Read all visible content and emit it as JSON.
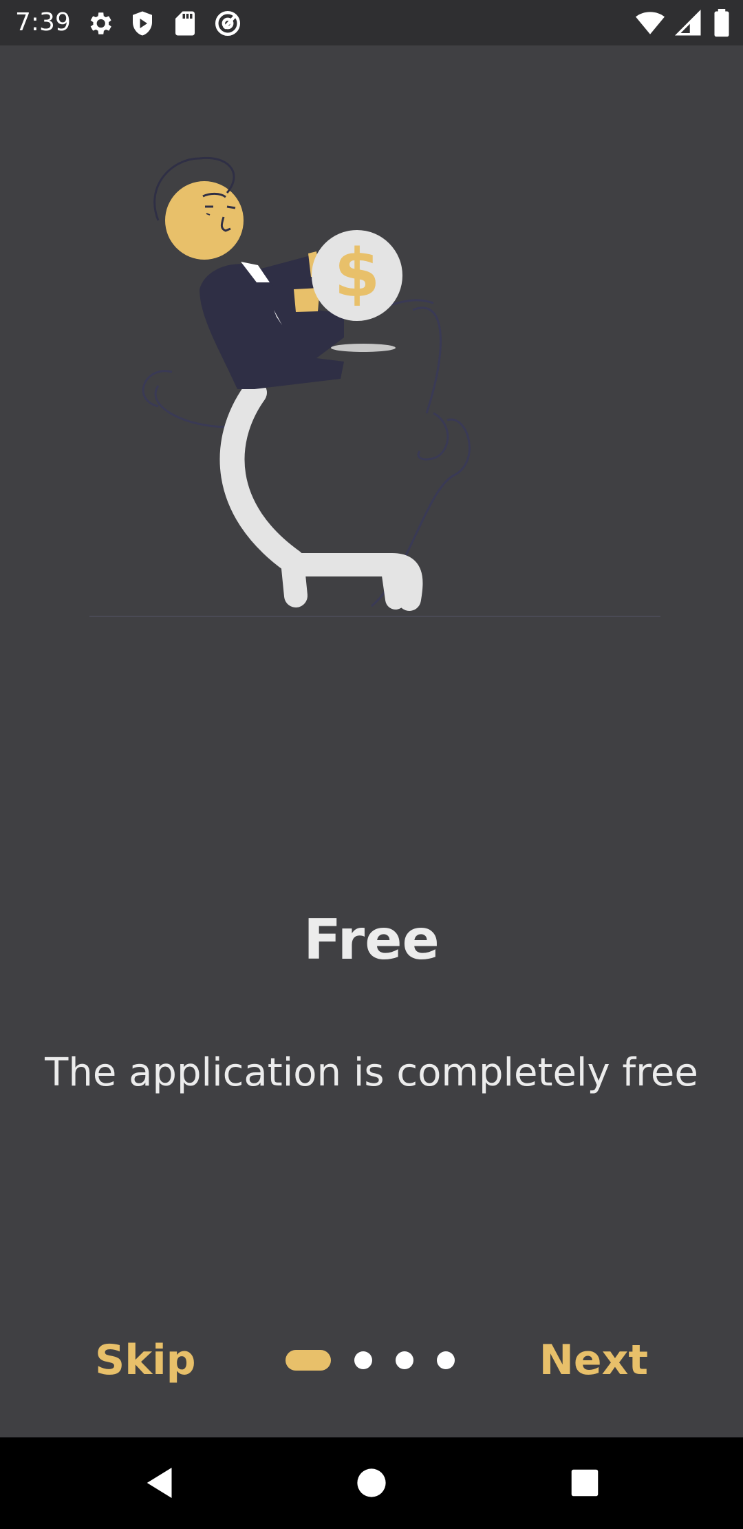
{
  "status_bar": {
    "time": "7:39",
    "left_icons": [
      "settings-icon",
      "shield-play-icon",
      "sd-card-icon",
      "at-sign-icon"
    ],
    "right_icons": [
      "wifi-icon",
      "signal-icon",
      "battery-icon"
    ]
  },
  "onboarding": {
    "title": "Free",
    "description": "The application is completely free",
    "skip_label": "Skip",
    "next_label": "Next",
    "page_count": 4,
    "current_page": 1
  },
  "colors": {
    "background": "#404043",
    "accent": "#e8c06a",
    "text": "#ececec"
  },
  "nav_bar": {
    "buttons": [
      "back-icon",
      "home-icon",
      "recents-icon"
    ]
  }
}
